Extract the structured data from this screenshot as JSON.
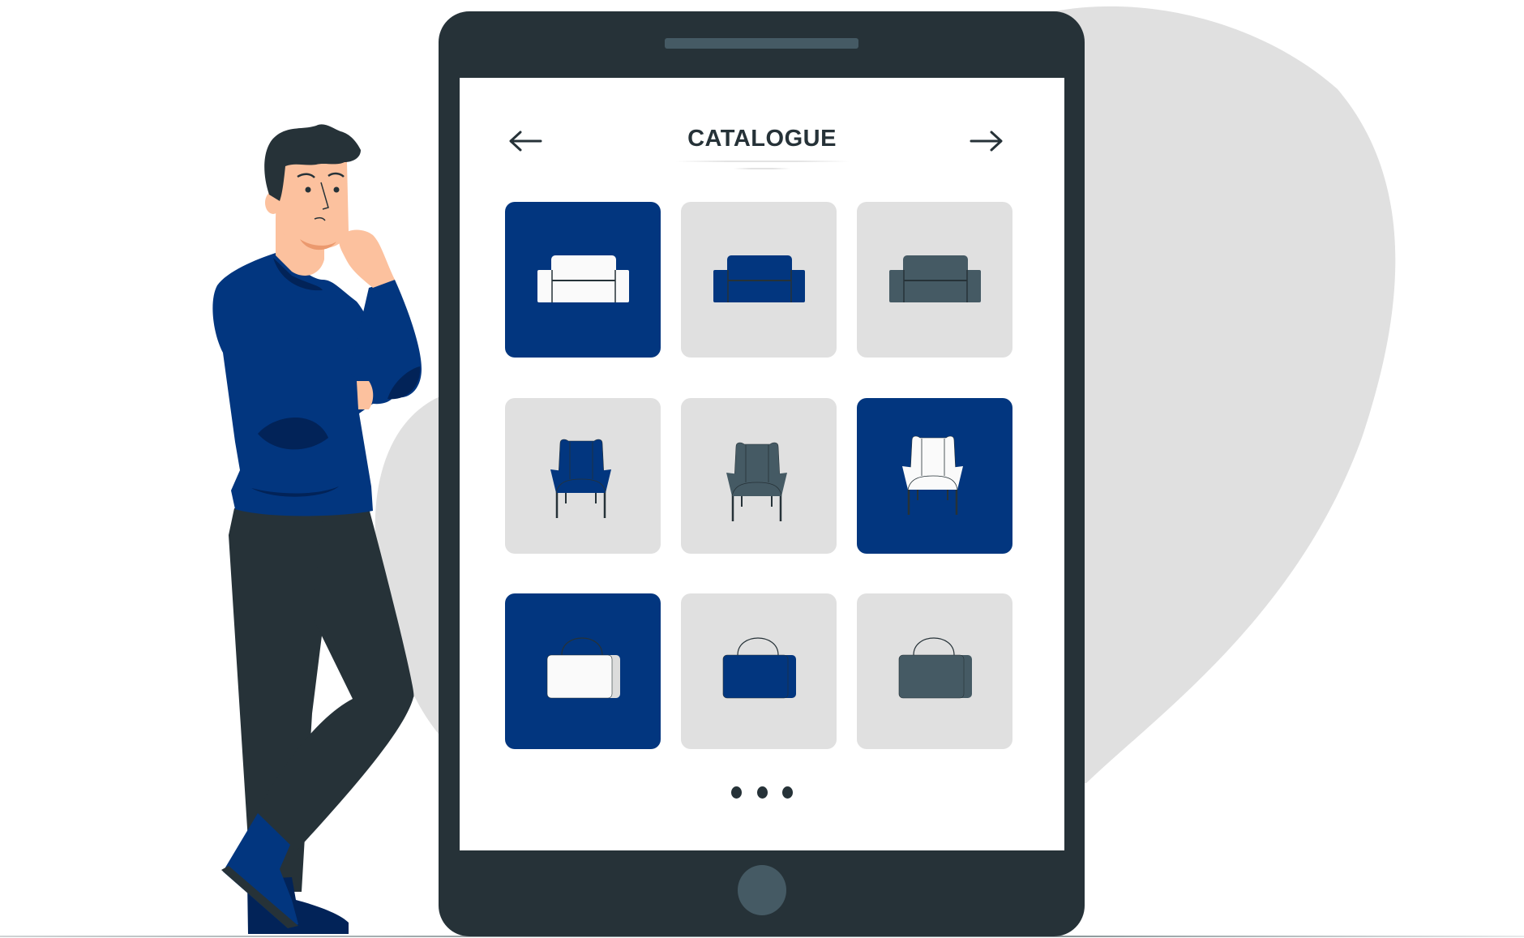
{
  "scene": {
    "description": "Person thinking beside a large phone showing a product catalogue",
    "colors": {
      "phone_body": "#263238",
      "phone_accent": "#455a64",
      "brand_blue": "#02367f",
      "card_gray": "#e0e0e0",
      "blob_gray": "#e0e0e0",
      "skin": "#fcc19e",
      "hair": "#263238",
      "pants": "#263238",
      "white": "#fafafa"
    }
  },
  "app": {
    "title": "CATALOGUE",
    "prev_icon": "arrow-left-icon",
    "next_icon": "arrow-right-icon",
    "pagination": {
      "dots": 3,
      "icon": "more-dots-icon"
    },
    "grid": [
      {
        "product": "sofa",
        "variant": "white",
        "selected": true
      },
      {
        "product": "sofa",
        "variant": "blue",
        "selected": false
      },
      {
        "product": "sofa",
        "variant": "slate",
        "selected": false
      },
      {
        "product": "armchair",
        "variant": "blue",
        "selected": false
      },
      {
        "product": "armchair",
        "variant": "slate",
        "selected": false
      },
      {
        "product": "armchair",
        "variant": "white",
        "selected": true
      },
      {
        "product": "handbag",
        "variant": "white",
        "selected": true
      },
      {
        "product": "handbag",
        "variant": "blue",
        "selected": false
      },
      {
        "product": "handbag",
        "variant": "slate",
        "selected": false
      }
    ]
  }
}
